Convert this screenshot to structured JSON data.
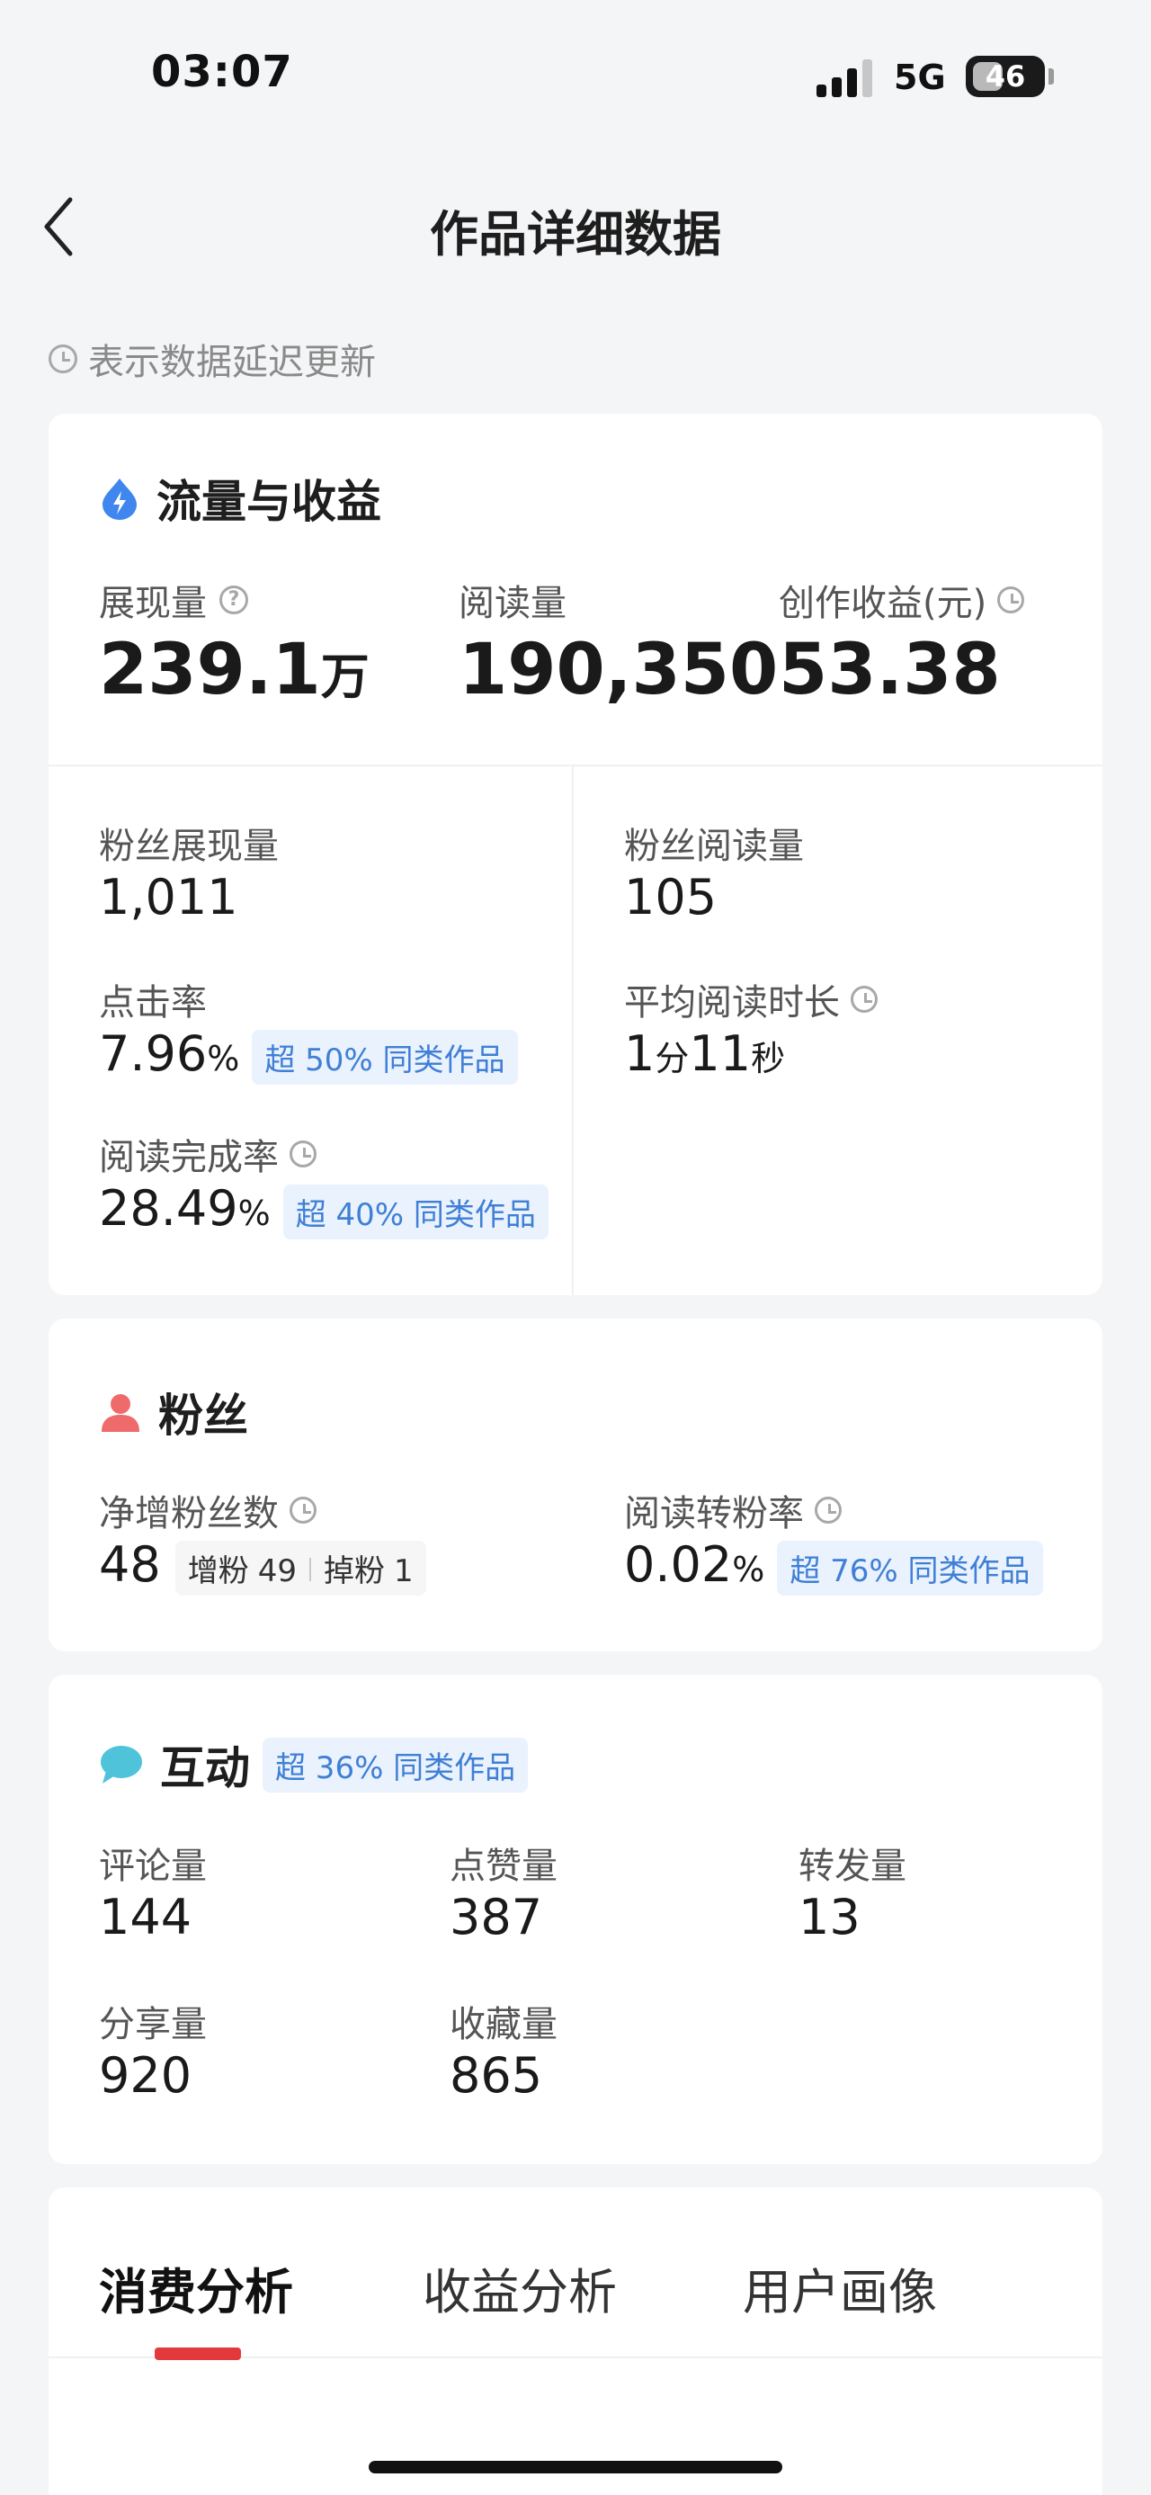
{
  "status_bar": {
    "time": "03:07",
    "network": "5G",
    "battery": "46",
    "battery_level": 0.46
  },
  "nav": {
    "title": "作品详细数据",
    "back_icon": "chevron-left-icon"
  },
  "delay_note": "表示数据延迟更新",
  "traffic": {
    "title": "流量与收益",
    "impressions": {
      "label": "展现量",
      "value": "239.1",
      "unit": "万"
    },
    "reads": {
      "label": "阅读量",
      "value": "190,350"
    },
    "earnings": {
      "label": "创作收益(元)",
      "value": "53.38"
    },
    "fan_impressions": {
      "label": "粉丝展现量",
      "value": "1,011"
    },
    "fan_reads": {
      "label": "粉丝阅读量",
      "value": "105"
    },
    "ctr": {
      "label": "点击率",
      "value": "7.96",
      "unit": "%",
      "badge": "超 50% 同类作品"
    },
    "avg_read_time": {
      "label": "平均阅读时长",
      "v1": "1",
      "u1": "分",
      "v2": "11",
      "u2": "秒"
    },
    "completion": {
      "label": "阅读完成率",
      "value": "28.49",
      "unit": "%",
      "badge": "超 40% 同类作品"
    }
  },
  "fans": {
    "title": "粉丝",
    "net_fans": {
      "label": "净增粉丝数",
      "value": "48",
      "gain_label": "增粉",
      "gain": "49",
      "loss_label": "掉粉",
      "loss": "1"
    },
    "conversion": {
      "label": "阅读转粉率",
      "value": "0.02",
      "unit": "%",
      "badge": "超 76% 同类作品"
    }
  },
  "interaction": {
    "title": "互动",
    "badge": "超 36% 同类作品",
    "comments": {
      "label": "评论量",
      "value": "144"
    },
    "likes": {
      "label": "点赞量",
      "value": "387"
    },
    "reposts": {
      "label": "转发量",
      "value": "13"
    },
    "shares": {
      "label": "分享量",
      "value": "920"
    },
    "favorites": {
      "label": "收藏量",
      "value": "865"
    }
  },
  "tabs": [
    "消费分析",
    "收益分析",
    "用户画像"
  ],
  "colors": {
    "accent_blue": "#3f7fd6",
    "badge_bg": "#eaf2fd",
    "fans_icon": "#ef6b6b",
    "chat_icon": "#4fc3d9",
    "tab_indicator": "#e4393c"
  }
}
